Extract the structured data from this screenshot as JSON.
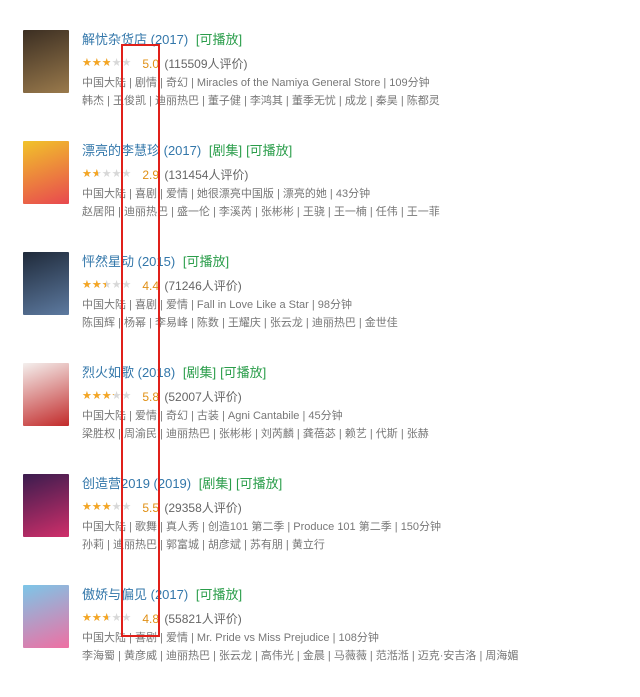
{
  "items": [
    {
      "title": "解忧杂货店 (2017)",
      "tags": [
        "[可播放]"
      ],
      "rating_fraction": 0.5,
      "score": "5.0",
      "count": "(115509人评价)",
      "meta": "中国大陆 | 剧情 | 奇幻 | Miracles of the Namiya General Store | 109分钟",
      "cast": "韩杰 | 王俊凯 | 迪丽热巴 | 董子健 | 李鸿其 | 董季无忧 | 成龙 | 秦昊 | 陈都灵",
      "poster_colors": [
        "#3b2e22",
        "#9a7a4c"
      ]
    },
    {
      "title": "漂亮的李慧珍 (2017)",
      "tags": [
        "[剧集]",
        "[可播放]"
      ],
      "rating_fraction": 0.29,
      "score": "2.9",
      "count": "(131454人评价)",
      "meta": "中国大陆 | 喜剧 | 爱情 | 她很漂亮中国版 | 漂亮的她 | 43分钟",
      "cast": "赵居阳 | 迪丽热巴 | 盛一伦 | 李溪芮 | 张彬彬 | 王骁 | 王一楠 | 任伟 | 王一菲",
      "poster_colors": [
        "#f1c32a",
        "#e8484f"
      ]
    },
    {
      "title": "怦然星动 (2015)",
      "tags": [
        "[可播放]"
      ],
      "rating_fraction": 0.44,
      "score": "4.4",
      "count": "(71246人评价)",
      "meta": "中国大陆 | 喜剧 | 爱情 | Fall in Love Like a Star | 98分钟",
      "cast": "陈国辉 | 杨幂 | 李易峰 | 陈数 | 王耀庆 | 张云龙 | 迪丽热巴 | 金世佳",
      "poster_colors": [
        "#1f2a3a",
        "#5d7aa0"
      ]
    },
    {
      "title": "烈火如歌 (2018)",
      "tags": [
        "[剧集]",
        "[可播放]"
      ],
      "rating_fraction": 0.58,
      "score": "5.8",
      "count": "(52007人评价)",
      "meta": "中国大陆 | 爱情 | 奇幻 | 古装 | Agni Cantabile | 45分钟",
      "cast": "梁胜权 | 周渝民 | 迪丽热巴 | 张彬彬 | 刘芮麟 | 龚蓓苾 | 赖艺 | 代斯 | 张赫",
      "poster_colors": [
        "#f4f0ee",
        "#c22a2a"
      ]
    },
    {
      "title": "创造营2019 (2019)",
      "tags": [
        "[剧集]",
        "[可播放]"
      ],
      "rating_fraction": 0.55,
      "score": "5.5",
      "count": "(29358人评价)",
      "meta": "中国大陆 | 歌舞 | 真人秀 | 创造101 第二季 | Produce 101 第二季 | 150分钟",
      "cast": "孙莉 | 迪丽热巴 | 郭富城 | 胡彦斌 | 苏有朋 | 黄立行",
      "poster_colors": [
        "#3a1c4e",
        "#d02f6a"
      ]
    },
    {
      "title": "傲娇与偏见 (2017)",
      "tags": [
        "[可播放]"
      ],
      "rating_fraction": 0.48,
      "score": "4.8",
      "count": "(55821人评价)",
      "meta": "中国大陆 | 喜剧 | 爱情 | Mr. Pride vs Miss Prejudice | 108分钟",
      "cast": "李海蜀 | 黄彦威 | 迪丽热巴 | 张云龙 | 高伟光 | 金晨 | 马薇薇 | 范湉湉 | 迈克·安吉洛 | 周海媚",
      "poster_colors": [
        "#7cc6e8",
        "#ef6fa2"
      ]
    }
  ],
  "star_glyphs": "★★★★★",
  "highlight_color": "#e0201a"
}
